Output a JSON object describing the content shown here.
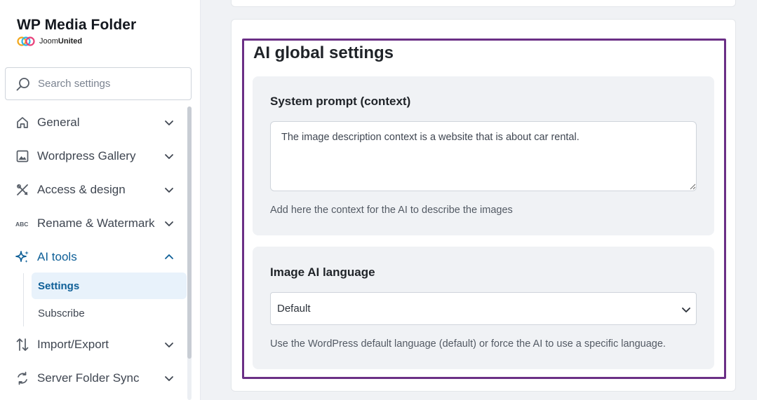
{
  "brand": {
    "title": "WP Media Folder",
    "company_prefix": "Joom",
    "company_suffix": "United"
  },
  "search": {
    "placeholder": "Search settings"
  },
  "nav": {
    "items": [
      {
        "label": "General",
        "icon": "home-icon"
      },
      {
        "label": "Wordpress Gallery",
        "icon": "image-icon"
      },
      {
        "label": "Access & design",
        "icon": "design-tools-icon"
      },
      {
        "label": "Rename & Watermark",
        "icon": "abc-icon"
      },
      {
        "label": "AI tools",
        "icon": "sparkles-icon"
      },
      {
        "label": "Import/Export",
        "icon": "import-export-icon"
      },
      {
        "label": "Server Folder Sync",
        "icon": "sync-icon"
      }
    ],
    "ai_sub": [
      {
        "label": "Settings"
      },
      {
        "label": "Subscribe"
      }
    ]
  },
  "main": {
    "section_title": "AI global settings",
    "system_prompt": {
      "label": "System prompt (context)",
      "value": "The image description context is a website that is about car rental.",
      "help": "Add here the context for the AI to describe the images"
    },
    "language": {
      "label": "Image AI language",
      "selected": "Default",
      "help": "Use the WordPress default language (default) or force the AI to use a specific language."
    }
  },
  "colors": {
    "accent": "#0e5f97",
    "highlight_border": "#6b2f86",
    "selected_bg": "#e8f2fb"
  }
}
